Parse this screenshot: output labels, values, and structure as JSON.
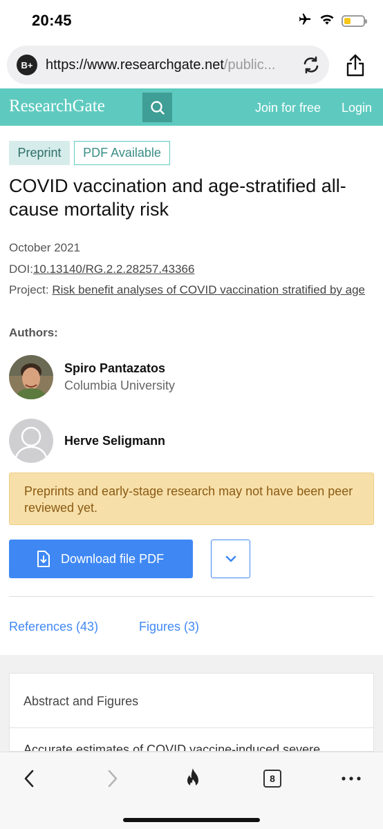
{
  "status_bar": {
    "time": "20:45",
    "icons": [
      "airplane-icon",
      "wifi-icon",
      "battery-icon"
    ]
  },
  "browser": {
    "badge_label": "B+",
    "url_host": "https://www.researchgate.net",
    "url_path": "/public...",
    "icons": [
      "reload-icon",
      "share-icon"
    ]
  },
  "header": {
    "logo": "ResearchGate",
    "join": "Join for free",
    "login": "Login",
    "bg_color": "#5ecabf"
  },
  "badges": {
    "preprint": "Preprint",
    "pdf": "PDF Available"
  },
  "article": {
    "title": "COVID vaccination and age-stratified all-cause mortality risk",
    "date": "October 2021",
    "doi_label": "DOI:",
    "doi": "10.13140/RG.2.2.28257.43366",
    "project_label": "Project:",
    "project": "Risk benefit analyses of COVID vaccination stratified by age"
  },
  "authors": {
    "label": "Authors:",
    "list": [
      {
        "name": "Spiro Pantazatos",
        "affiliation": "Columbia University"
      },
      {
        "name": "Herve Seligmann",
        "affiliation": ""
      }
    ]
  },
  "notice": "Preprints and early-stage research may not have been peer reviewed yet.",
  "download": {
    "label": "Download file PDF",
    "accent": "#3f88f4"
  },
  "tabs": {
    "references": "References (43)",
    "figures": "Figures (3)"
  },
  "abstract": {
    "title": "Abstract and Figures",
    "text": "Accurate estimates of COVID vaccine-induced severe"
  },
  "toolbar": {
    "tab_count": "8",
    "icons": [
      "back-icon",
      "forward-icon",
      "fire-icon",
      "tabs-icon",
      "more-icon"
    ]
  }
}
